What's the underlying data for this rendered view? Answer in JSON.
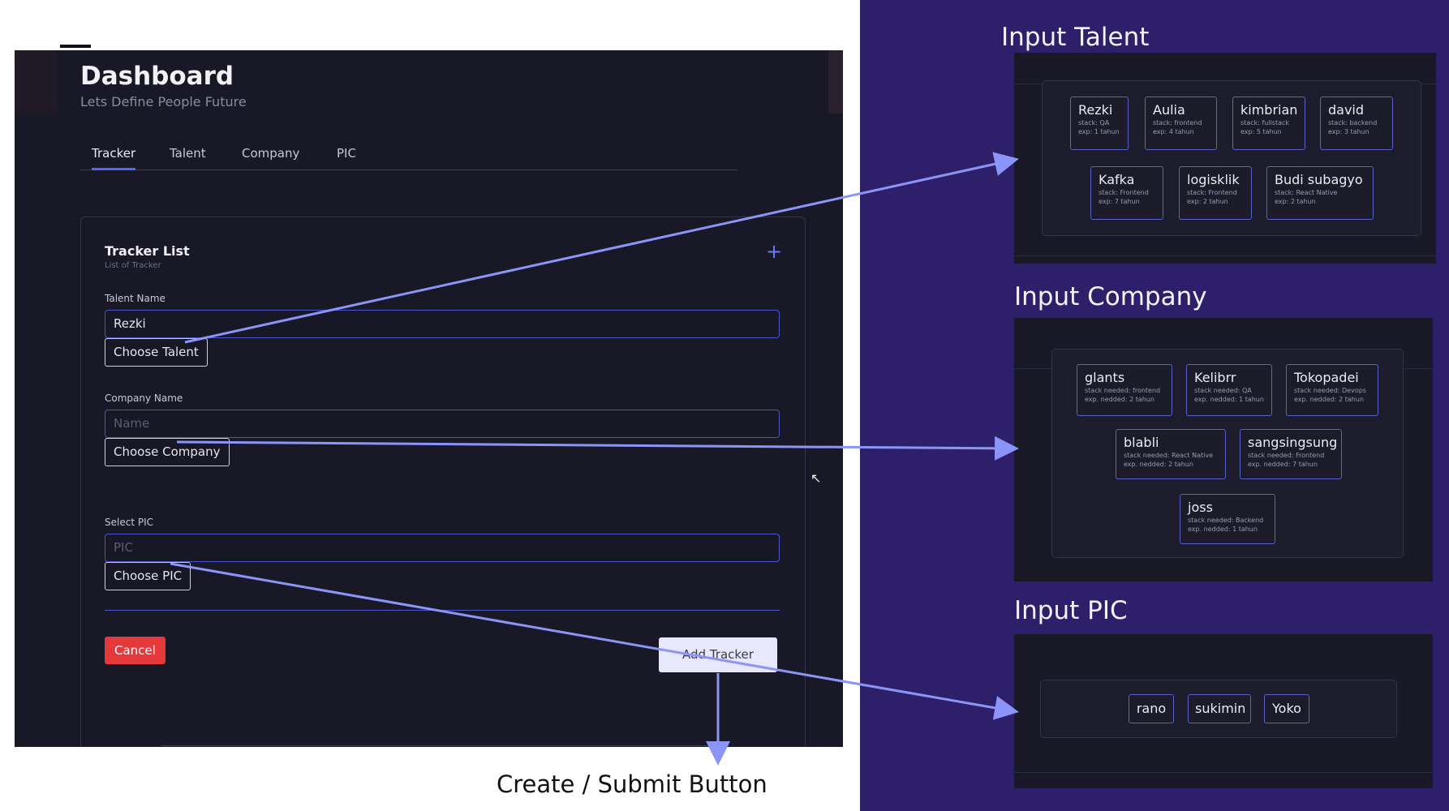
{
  "dashboard": {
    "title": "Dashboard",
    "subtitle": "Lets Define People Future",
    "tabs": [
      {
        "label": "Tracker",
        "active": true
      },
      {
        "label": "Talent",
        "active": false
      },
      {
        "label": "Company",
        "active": false
      },
      {
        "label": "PIC",
        "active": false
      }
    ],
    "card": {
      "title": "Tracker List",
      "subtitle": "List of Tracker",
      "add_icon": "plus-icon",
      "talent": {
        "label": "Talent Name",
        "value": "Rezki",
        "button": "Choose Talent"
      },
      "company": {
        "label": "Company Name",
        "placeholder": "Name",
        "button": "Choose Company"
      },
      "pic": {
        "label": "Select PIC",
        "placeholder": "PIC",
        "button": "Choose PIC"
      },
      "cancel": "Cancel",
      "submit": "Add Tracker"
    }
  },
  "caption": "Create / Submit Button",
  "sections": {
    "talent": {
      "title": "Input Talent",
      "items": [
        {
          "name": "Rezki",
          "l1": "stack: QA",
          "l2": "exp: 1 tahun"
        },
        {
          "name": "Aulia",
          "l1": "stack: frontend",
          "l2": "exp: 4 tahun"
        },
        {
          "name": "kimbrian",
          "l1": "stack: fullstack",
          "l2": "exp: 5 tahun"
        },
        {
          "name": "david",
          "l1": "stack: backend",
          "l2": "exp: 3 tahun"
        },
        {
          "name": "Kafka",
          "l1": "stack: Frontend",
          "l2": "exp: 7 tahun"
        },
        {
          "name": "logisklik",
          "l1": "stack: Frontend",
          "l2": "exp: 2 tahun"
        },
        {
          "name": "Budi subagyo",
          "l1": "stack: React Native",
          "l2": "exp: 2 tahun"
        }
      ]
    },
    "company": {
      "title": "Input Company",
      "items": [
        {
          "name": "glants",
          "l1": "stack needed: frontend",
          "l2": "exp. nedded: 2 tahun"
        },
        {
          "name": "Kelibrr",
          "l1": "stack needed: QA",
          "l2": "exp. nedded: 1 tahun"
        },
        {
          "name": "Tokopadei",
          "l1": "stack needed: Devops",
          "l2": "exp. nedded: 2 tahun"
        },
        {
          "name": "blabli",
          "l1": "stack needed: React Native",
          "l2": "exp. nedded: 2 tahun"
        },
        {
          "name": "sangsingsung",
          "l1": "stack needed: Frontend",
          "l2": "exp. nedded: 7 tahun"
        },
        {
          "name": "joss",
          "l1": "stack needed: Backend",
          "l2": "exp. nedded: 1 tahun"
        }
      ]
    },
    "pic": {
      "title": "Input PIC",
      "items": [
        {
          "name": "rano"
        },
        {
          "name": "sukimin"
        },
        {
          "name": "Yoko"
        }
      ]
    }
  },
  "colors": {
    "accent": "#5865f2",
    "arrow": "#8b95f7",
    "panel": "#2e1f6b",
    "cancel": "#e5383b"
  }
}
